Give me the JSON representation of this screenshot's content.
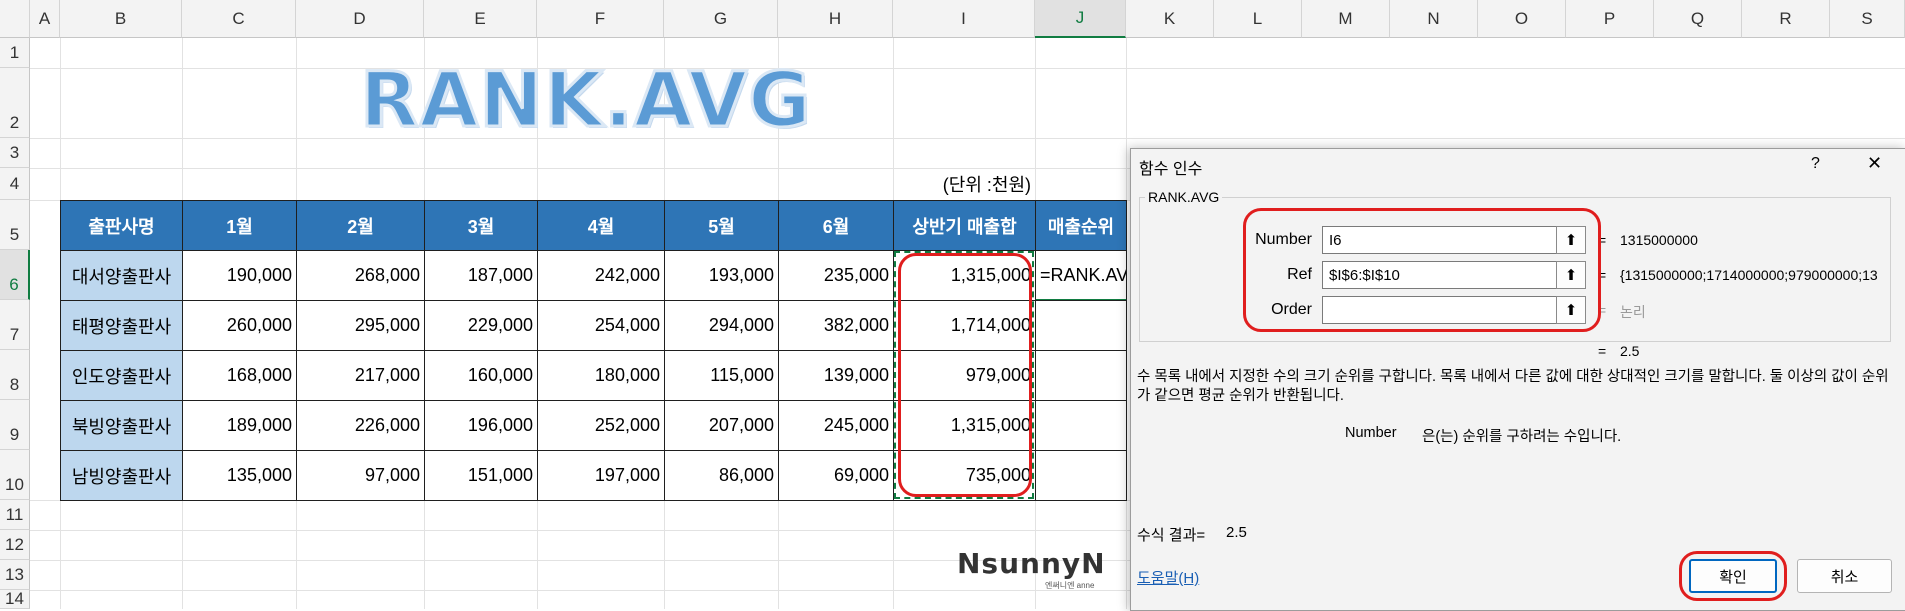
{
  "columns": [
    "A",
    "B",
    "C",
    "D",
    "E",
    "F",
    "G",
    "H",
    "I",
    "J",
    "K",
    "L",
    "M",
    "N",
    "O",
    "P",
    "Q",
    "R",
    "S"
  ],
  "rows": [
    "1",
    "2",
    "3",
    "4",
    "5",
    "6",
    "7",
    "8",
    "9",
    "10",
    "11",
    "12",
    "13",
    "14"
  ],
  "title": "RANK.AVG",
  "unit_note": "(단위 :천원)",
  "table": {
    "headers": [
      "출판사명",
      "1월",
      "2월",
      "3월",
      "4월",
      "5월",
      "6월",
      "상반기 매출합",
      "매출순위"
    ],
    "rows": [
      {
        "name": "대서양출판사",
        "values": [
          "190,000",
          "268,000",
          "187,000",
          "242,000",
          "193,000",
          "235,000",
          "1,315,000"
        ]
      },
      {
        "name": "태평양출판사",
        "values": [
          "260,000",
          "295,000",
          "229,000",
          "254,000",
          "294,000",
          "382,000",
          "1,714,000"
        ]
      },
      {
        "name": "인도양출판사",
        "values": [
          "168,000",
          "217,000",
          "160,000",
          "180,000",
          "115,000",
          "139,000",
          "979,000"
        ]
      },
      {
        "name": "북빙양출판사",
        "values": [
          "189,000",
          "226,000",
          "196,000",
          "252,000",
          "207,000",
          "245,000",
          "1,315,000"
        ]
      },
      {
        "name": "남빙양출판사",
        "values": [
          "135,000",
          "97,000",
          "151,000",
          "197,000",
          "86,000",
          "69,000",
          "735,000"
        ]
      }
    ],
    "formula_cell": "=RANK.AVG("
  },
  "watermark": {
    "brand": "NsunnyN",
    "sub": "엔써니엔 anne"
  },
  "dialog": {
    "title": "함수 인수",
    "help_glyph": "?",
    "close_glyph": "✕",
    "function_name": "RANK.AVG",
    "args": [
      {
        "label": "Number",
        "value": "I6",
        "result": "1315000000",
        "button": "⬆"
      },
      {
        "label": "Ref",
        "value": "$I$6:$I$10",
        "result": "{1315000000;1714000000;979000000;13",
        "button": "⬆"
      },
      {
        "label": "Order",
        "value": "",
        "result": "논리",
        "button": "⬆"
      }
    ],
    "equals": "=",
    "overall_result": "2.5",
    "description": "수 목록 내에서 지정한 수의 크기 순위를 구합니다. 목록 내에서 다른 값에 대한 상대적인 크기를 말합니다. 둘 이상의 값이 순위가 같으면 평균 순위가 반환됩니다.",
    "arg_desc_name": "Number",
    "arg_desc_text": "은(는) 순위를 구하려는 수입니다.",
    "formula_result_label": "수식 결과=",
    "formula_result_value": "2.5",
    "help_link": "도움말(H)",
    "ok_label": "확인",
    "cancel_label": "취소"
  },
  "colors": {
    "header_blue": "#2e75b6",
    "name_fill": "#bdd7ee",
    "title_blue": "#5b9bd5",
    "highlight_red": "#e01e1e",
    "excel_green": "#107c41"
  }
}
